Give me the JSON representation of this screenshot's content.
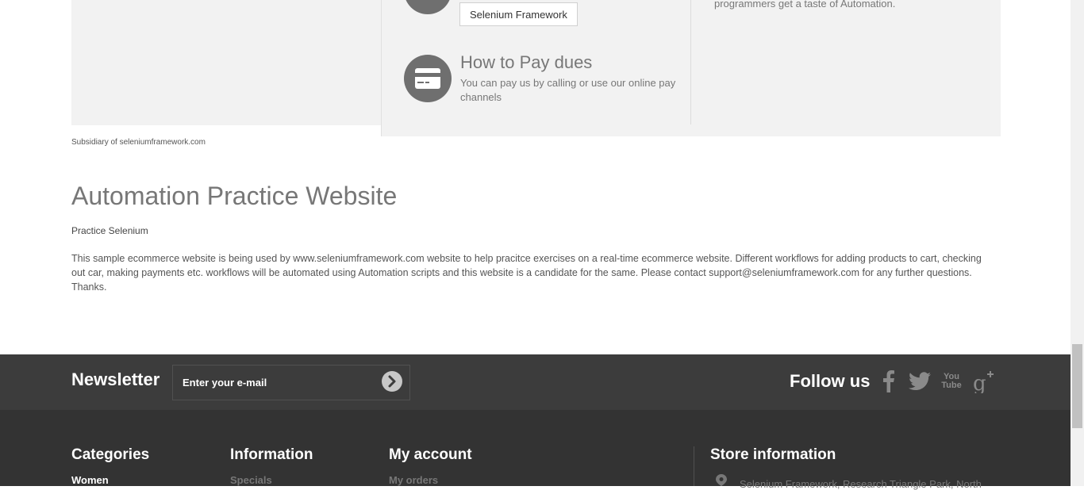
{
  "services": {
    "framework_button": "Selenium Framework",
    "pay_title": "How to Pay dues",
    "pay_text": "You can pay us by calling or use our online pay channels",
    "right_text": "programmers get a taste of Automation."
  },
  "subsidiary": "Subsidiary of seleniumframework.com",
  "site": {
    "title": "Automation Practice Website",
    "subtitle": "Practice Selenium",
    "description": "This sample ecommerce website is being used by www.seleniumframework.com website to help pracitce exercises on a real-time ecommerce website. Different workflows for adding products to cart, checking out car, making payments etc. workflows will be automated using Automation scripts and this website is a candidate for the same. Please contact support@seleniumframework.com for any further questions. Thanks."
  },
  "newsletter": {
    "title": "Newsletter",
    "placeholder": "Enter your e-mail"
  },
  "follow": {
    "title": "Follow us",
    "youtube_text": "You Tube"
  },
  "footer": {
    "categories": {
      "title": "Categories",
      "first": "Women"
    },
    "information": {
      "title": "Information",
      "first": "Specials"
    },
    "account": {
      "title": "My account",
      "first": "My orders"
    },
    "store": {
      "title": "Store information",
      "address": "Selenium Framework, Research Triangle Park, North"
    }
  },
  "colors": {
    "newsletter_bg": "#3c3c3c",
    "footer_bg": "#333333",
    "panel_bg": "#f2f2f2"
  }
}
